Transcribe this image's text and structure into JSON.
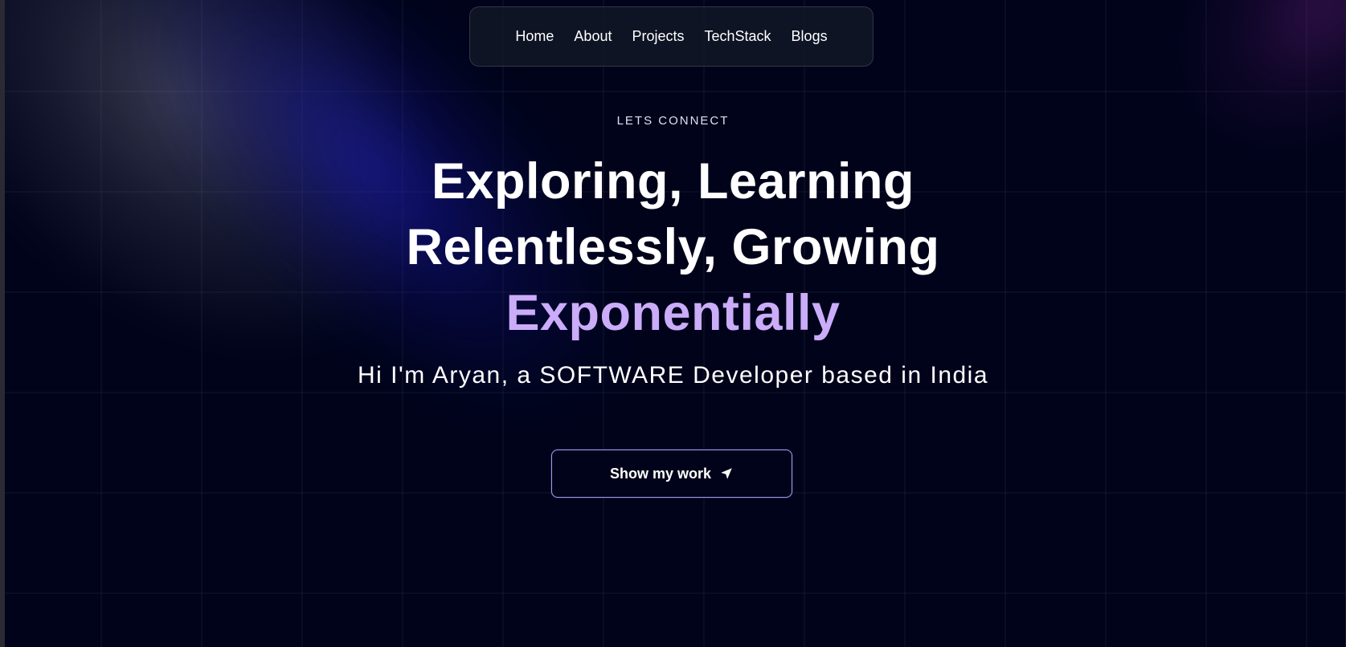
{
  "nav": {
    "items": [
      {
        "label": "Home"
      },
      {
        "label": "About"
      },
      {
        "label": "Projects"
      },
      {
        "label": "TechStack"
      },
      {
        "label": "Blogs"
      }
    ]
  },
  "hero": {
    "eyebrow": "LETS CONNECT",
    "headline_line1": "Exploring, Learning",
    "headline_line2": "Relentlessly, Growing",
    "headline_accent": "Exponentially",
    "subtitle": "Hi I'm Aryan, a SOFTWARE Developer based in India",
    "cta_label": "Show my work",
    "cta_icon": "location-arrow-icon"
  },
  "colors": {
    "background": "#000319",
    "accent": "#cbacf9",
    "cta_border": "#a39ae8"
  }
}
